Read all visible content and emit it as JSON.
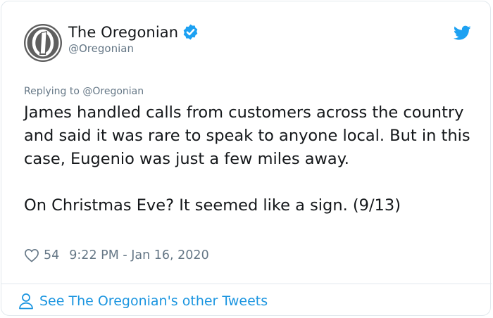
{
  "author": {
    "display_name": "The Oregonian",
    "handle": "@Oregonian",
    "verified": true,
    "avatar_icon": "oregonian-o-logo"
  },
  "tweet": {
    "replying_to": "Replying to @Oregonian",
    "paragraphs": [
      "James handled calls from customers across the country and said it was rare to speak to anyone local. But in this case, Eugenio was just a few miles away.",
      "On Christmas Eve? It seemed like a sign. (9/13)"
    ],
    "likes": "54",
    "timestamp": "9:22 PM - Jan 16, 2020"
  },
  "footer": {
    "link_label": "See The Oregonian's other Tweets"
  },
  "colors": {
    "text": "#14171a",
    "muted": "#657786",
    "accent": "#1b95e0",
    "verified": "#1da1f2",
    "border": "#e1e8ed"
  },
  "icons": {
    "brand": "twitter-bird-icon",
    "verified": "verified-badge-icon",
    "like": "heart-outline-icon",
    "profile": "person-outline-icon"
  }
}
